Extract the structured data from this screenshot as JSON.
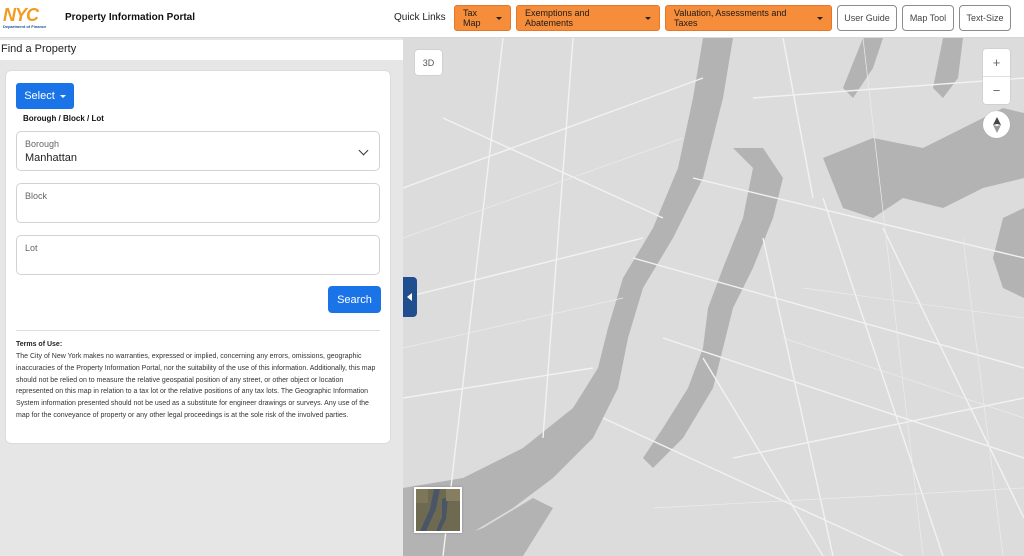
{
  "header": {
    "logo_text": "NYC",
    "logo_subtext": "Department of Finance",
    "portal_title": "Property Information Portal",
    "quick_links_label": "Quick Links",
    "menu_buttons": [
      {
        "label": "Tax Map"
      },
      {
        "label": "Exemptions and Abatements"
      },
      {
        "label": "Valuation, Assessments and Taxes"
      }
    ],
    "outline_buttons": [
      {
        "label": "User Guide"
      },
      {
        "label": "Map Tool"
      },
      {
        "label": "Text-Size"
      }
    ],
    "accent_color": "#f58d3a"
  },
  "left_panel": {
    "title": "Find a Property",
    "select_label": "Select",
    "mode_label": "Borough / Block / Lot",
    "borough": {
      "label": "Borough",
      "value": "Manhattan"
    },
    "block": {
      "label": "Block",
      "value": ""
    },
    "lot": {
      "label": "Lot",
      "value": ""
    },
    "search_label": "Search",
    "primary_color": "#1b73e8",
    "terms_title": "Terms of Use:",
    "terms_text": "The City of New York makes no warranties, expressed or implied, concerning any errors, omissions, geographic inaccuracies of the Property Information Portal, nor the suitability of the use of this information. Additionally, this map should not be relied on to measure the relative geospatial position of any street, or other object or location represented on this map in relation to a tax lot or the relative positions of any tax lots. The Geographic Information System information presented should not be used as a substitute for engineer drawings or surveys. Any use of the map for the conveyance of property or any other legal proceedings is at the sole risk of the involved parties."
  },
  "map": {
    "btn_3d": "3D",
    "zoom_in": "+",
    "zoom_out": "−",
    "compass_icon": "compass-icon",
    "collapse_icon": "chevron-left-icon",
    "basemap_thumbnail": "satellite-basemap-thumbnail"
  }
}
